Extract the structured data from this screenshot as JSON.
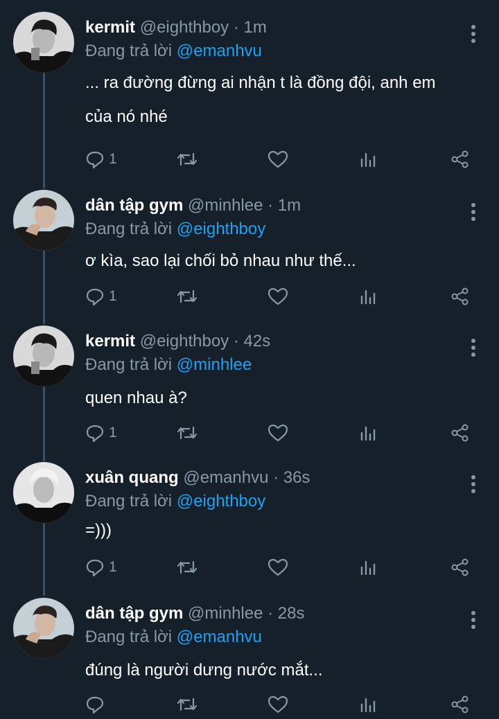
{
  "tweets": [
    {
      "name": "kermit",
      "handle": "@eighthboy",
      "time": "· 1m",
      "reply_prefix": "Đang trả lời",
      "reply_to": "@emanhvu",
      "lines": [
        "... ra đường đừng ai nhận t là đồng đội, anh em",
        "của nó nhé"
      ],
      "reply_count": "1",
      "avatar": "kermit-photo"
    },
    {
      "name": "dân tập gym",
      "handle": "@minhlee",
      "time": "· 1m",
      "reply_prefix": "Đang trả lời",
      "reply_to": "@eighthboy",
      "lines": [
        "ơ kìa, sao lại chối bỏ nhau như thế..."
      ],
      "reply_count": "1",
      "avatar": "gym-photo"
    },
    {
      "name": "kermit",
      "handle": "@eighthboy",
      "time": "· 42s",
      "reply_prefix": "Đang trả lời",
      "reply_to": "@minhlee",
      "lines": [
        "quen nhau à?"
      ],
      "reply_count": "1",
      "avatar": "kermit-photo"
    },
    {
      "name": "xuân quang",
      "handle": "@emanhvu",
      "time": "· 36s",
      "reply_prefix": "Đang trả lời",
      "reply_to": "@eighthboy",
      "lines": [
        "=)))"
      ],
      "reply_count": "1",
      "avatar": "quang-photo"
    },
    {
      "name": "dân tập gym",
      "handle": "@minhlee",
      "time": "· 28s",
      "reply_prefix": "Đang trả lời",
      "reply_to": "@emanhvu",
      "lines": [
        "đúng là người dưng nước mắt..."
      ],
      "reply_count": "",
      "avatar": "gym-photo"
    }
  ],
  "icons": {
    "reply": "reply-icon",
    "retweet": "retweet-icon",
    "like": "heart-icon",
    "analytics": "analytics-icon",
    "share": "share-icon",
    "more": "more-vertical-icon"
  },
  "colors": {
    "background": "#15202b",
    "secondary_text": "#8899a6",
    "mention": "#1da1f2",
    "thread_line": "#3d4f5e"
  }
}
